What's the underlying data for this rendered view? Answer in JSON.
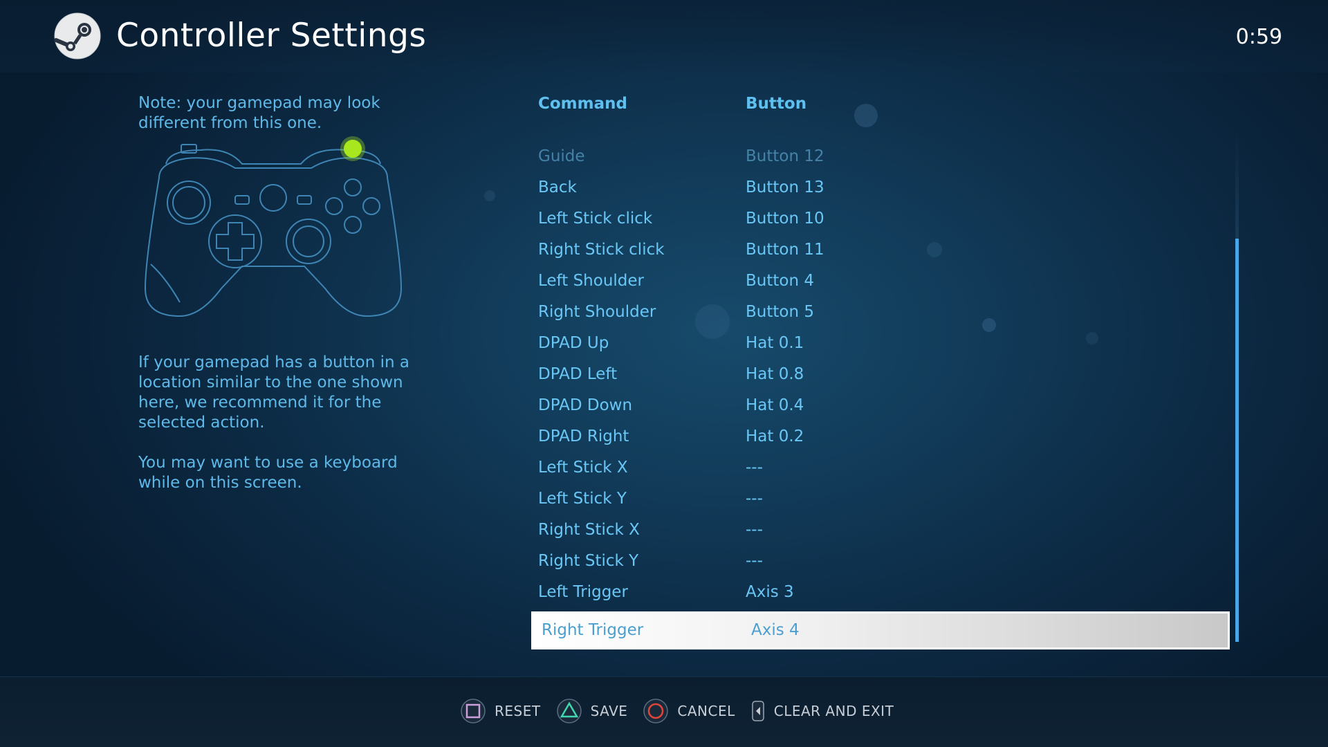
{
  "header": {
    "title": "Controller Settings",
    "clock": "0:59"
  },
  "left_panel": {
    "note": "Note: your gamepad may look different from this one.",
    "help_1": "If your gamepad has a button in a location similar to the one shown here, we recommend it for the selected action.",
    "help_2": "You may want to use a keyboard while on this screen."
  },
  "table": {
    "col_command": "Command",
    "col_button": "Button",
    "rows": [
      {
        "command": "Guide",
        "button": "Button 12"
      },
      {
        "command": "Back",
        "button": "Button 13"
      },
      {
        "command": "Left Stick click",
        "button": "Button 10"
      },
      {
        "command": "Right Stick click",
        "button": "Button 11"
      },
      {
        "command": "Left Shoulder",
        "button": "Button 4"
      },
      {
        "command": "Right Shoulder",
        "button": "Button 5"
      },
      {
        "command": "DPAD Up",
        "button": "Hat 0.1"
      },
      {
        "command": "DPAD Left",
        "button": "Hat 0.8"
      },
      {
        "command": "DPAD Down",
        "button": "Hat 0.4"
      },
      {
        "command": "DPAD Right",
        "button": "Hat 0.2"
      },
      {
        "command": "Left Stick X",
        "button": "---"
      },
      {
        "command": "Left Stick Y",
        "button": "---"
      },
      {
        "command": "Right Stick X",
        "button": "---"
      },
      {
        "command": "Right Stick Y",
        "button": "---"
      },
      {
        "command": "Left Trigger",
        "button": "Axis 3"
      },
      {
        "command": "Right Trigger",
        "button": "Axis 4"
      }
    ],
    "selected_index": 15
  },
  "footer": {
    "reset": "RESET",
    "save": "SAVE",
    "cancel": "CANCEL",
    "clear_exit": "CLEAR AND EXIT"
  },
  "colors": {
    "accent": "#5fc0ef",
    "highlight_dot": "#a8e61d",
    "reset_icon": "#c9a0dc",
    "save_icon": "#3fd8b0",
    "cancel_icon": "#e0453a"
  }
}
